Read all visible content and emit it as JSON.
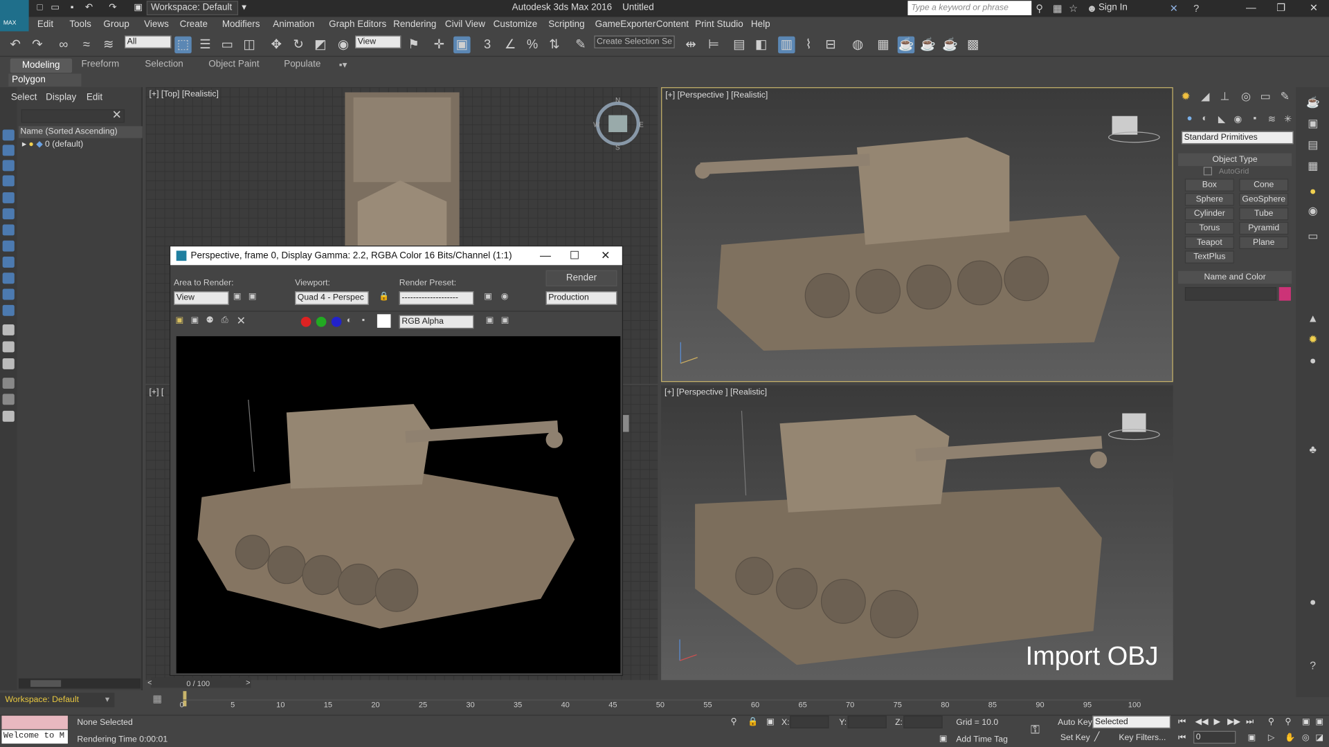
{
  "app": {
    "title": "Autodesk 3ds Max 2016",
    "document": "Untitled",
    "logo_text": "MAX",
    "workspace": "Workspace: Default",
    "search_placeholder": "Type a keyword or phrase",
    "sign_in": "Sign In"
  },
  "menu": [
    "Edit",
    "Tools",
    "Group",
    "Views",
    "Create",
    "Modifiers",
    "Animation",
    "Graph Editors",
    "Rendering",
    "Civil View",
    "Customize",
    "Scripting",
    "GameExporter",
    "Content",
    "Print Studio",
    "Help"
  ],
  "toolbar": {
    "filter": "All",
    "ref_coord": "View",
    "selection_set": "Create Selection Se"
  },
  "ribbon": {
    "tabs": [
      "Modeling",
      "Freeform",
      "Selection",
      "Object Paint",
      "Populate"
    ],
    "panel": "Polygon Modeling"
  },
  "explorer": {
    "tabs": [
      "Select",
      "Display",
      "Edit"
    ],
    "column": "Name (Sorted Ascending)",
    "layer": "0 (default)"
  },
  "viewports": {
    "top": "[+] [Top] [Realistic]",
    "front": "[+] [",
    "persp1": "[+] [Perspective ] [Realistic]",
    "persp2": "[+] [Perspective ] [Realistic]",
    "compass": {
      "n": "N",
      "s": "S",
      "e": "E",
      "w": "W"
    },
    "overlay_text": "Import OBJ"
  },
  "render_window": {
    "title": "Perspective, frame 0, Display Gamma: 2.2, RGBA Color 16 Bits/Channel (1:1)",
    "area_label": "Area to Render:",
    "area_value": "View",
    "viewport_label": "Viewport:",
    "viewport_value": "Quad 4 - Perspec",
    "preset_label": "Render Preset:",
    "preset_value": "--------------------",
    "render_button": "Render",
    "production": "Production",
    "channel": "RGB Alpha"
  },
  "command_panel": {
    "primitive_type": "Standard Primitives",
    "object_type_title": "Object Type",
    "autogrid": "AutoGrid",
    "buttons": [
      "Box",
      "Cone",
      "Sphere",
      "GeoSphere",
      "Cylinder",
      "Tube",
      "Torus",
      "Pyramid",
      "Teapot",
      "Plane",
      "TextPlus"
    ],
    "name_color_title": "Name and Color",
    "object_color": "#cc3377"
  },
  "timeline": {
    "frame": "0 / 100",
    "ticks": [
      "0",
      "5",
      "10",
      "15",
      "20",
      "25",
      "30",
      "35",
      "40",
      "45",
      "50",
      "55",
      "60",
      "65",
      "70",
      "75",
      "80",
      "85",
      "90",
      "95",
      "100"
    ]
  },
  "status": {
    "workspace": "Workspace: Default",
    "maxscript": "Welcome to M",
    "selection": "None Selected",
    "render_time": "Rendering Time  0:00:01",
    "x_label": "X:",
    "y_label": "Y:",
    "z_label": "Z:",
    "grid": "Grid = 10.0",
    "add_time_tag": "Add Time Tag",
    "auto_key": "Auto Key",
    "set_key": "Set Key",
    "key_mode": "Selected",
    "key_filters": "Key Filters...",
    "frame_field": "0"
  },
  "colors": {
    "accent": "#5b87b4",
    "viewport_active_border": "#c9b56b",
    "tank": "#8d7d6c"
  }
}
